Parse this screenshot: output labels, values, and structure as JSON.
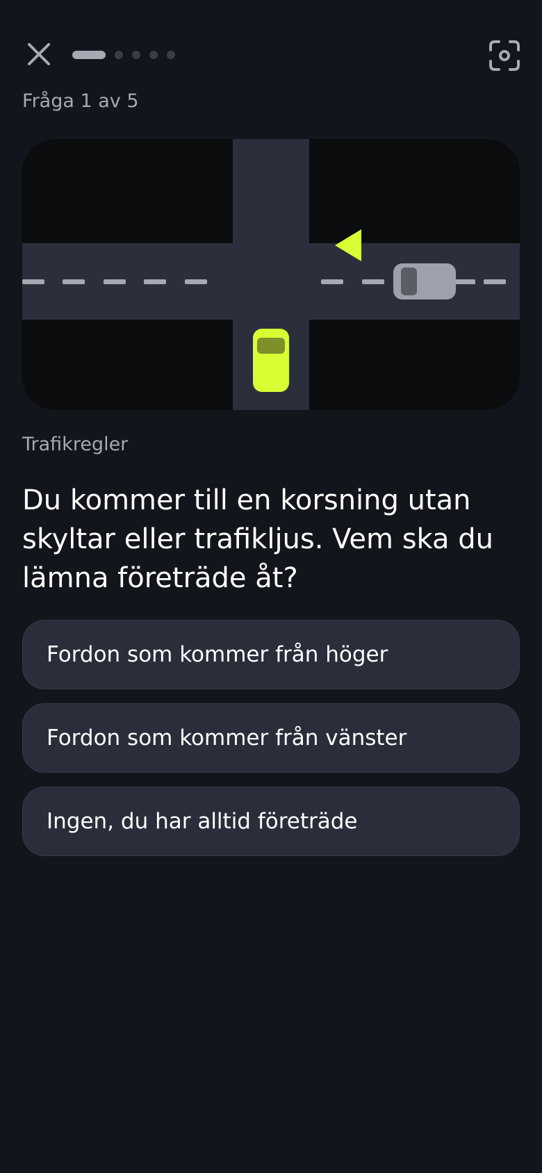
{
  "header": {
    "close_icon": "close-icon",
    "scan_icon": "scan-icon",
    "progress": {
      "current": 1,
      "total": 5
    }
  },
  "question": {
    "counter": "Fråga 1 av 5",
    "category": "Trafikregler",
    "text": "Du kommer till en korsning utan skyltar eller trafikljus. Vem ska du lämna företräde åt?"
  },
  "options": [
    {
      "label": "Fordon som kommer från höger"
    },
    {
      "label": "Fordon som kommer från vänster"
    },
    {
      "label": "Ingen, du har alltid företräde"
    }
  ],
  "colors": {
    "background": "#12151c",
    "road": "#2b2f3b",
    "accent": "#d7ff33",
    "other_car": "#9ea1ab",
    "option_bg": "#2a2e3b"
  }
}
